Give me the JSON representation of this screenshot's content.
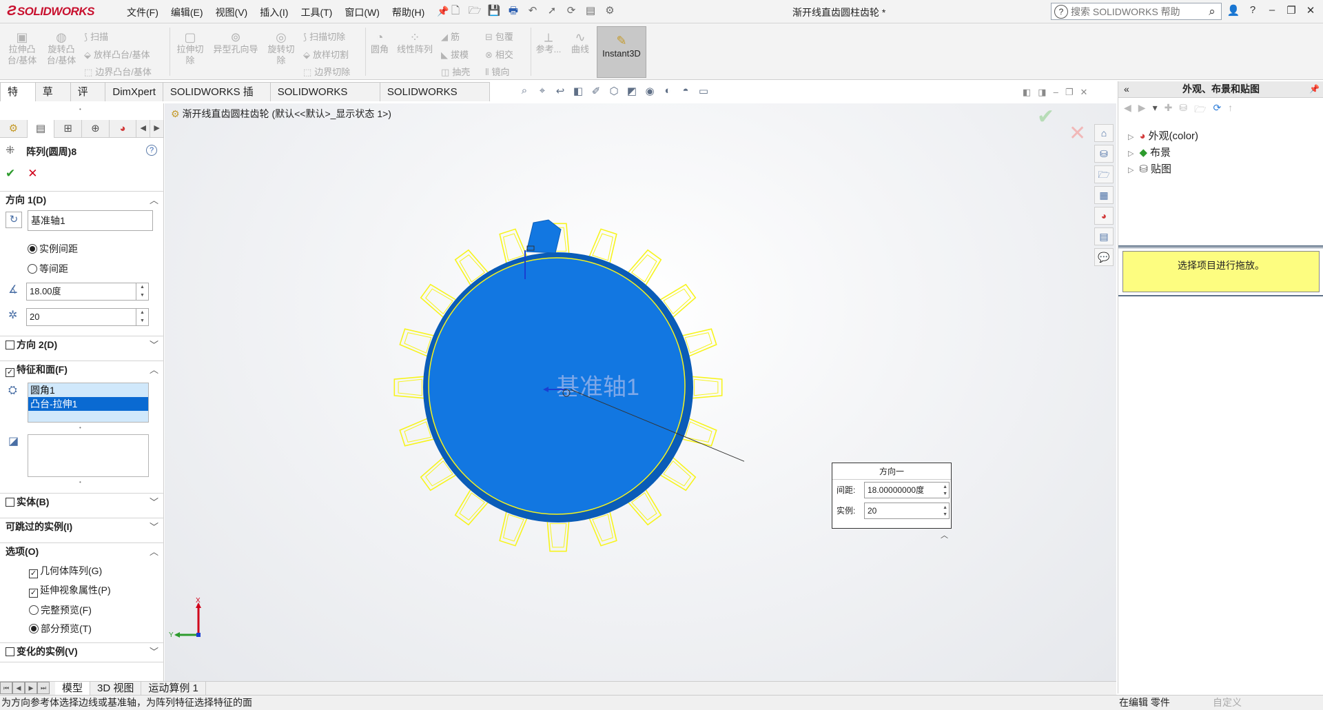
{
  "app": {
    "logo": "SOLIDWORKS",
    "document_title": "渐开线直齿圆柱齿轮 *",
    "menus": [
      "文件(F)",
      "编辑(E)",
      "视图(V)",
      "插入(I)",
      "工具(T)",
      "窗口(W)",
      "帮助(H)"
    ],
    "search_placeholder": "搜索 SOLIDWORKS 帮助"
  },
  "command_manager": {
    "extrude_boss": "拉伸凸\n台/基体",
    "revolve_boss": "旋转凸\n台/基体",
    "sweep": "扫描",
    "loft": "放样凸台/基体",
    "boundary": "边界凸台/基体",
    "extrude_cut": "拉伸切\n除",
    "hole_wizard": "异型孔向导",
    "revolve_cut": "旋转切\n除",
    "swept_cut": "扫描切除",
    "lofted_cut": "放样切割",
    "boundary_cut": "边界切除",
    "fillet": "圆角",
    "linear_pattern": "线性阵列",
    "rib": "筋",
    "draft": "拔模",
    "shell": "抽壳",
    "wrap": "包覆",
    "intersect": "相交",
    "mirror": "镜向",
    "reference": "参考...",
    "curves": "曲线",
    "instant3d": "Instant3D"
  },
  "tabs": [
    "特征",
    "草图",
    "评估",
    "DimXpert",
    "SOLIDWORKS 插件",
    "SOLIDWORKS MBD",
    "SOLIDWORKS CAM"
  ],
  "property_manager": {
    "title": "阵列(圆周)8",
    "direction1": {
      "header": "方向 1(D)",
      "axis": "基准轴1",
      "instance_spacing": "实例间距",
      "equal_spacing": "等间距",
      "angle": "18.00度",
      "count": "20"
    },
    "direction2": {
      "header": "方向 2(D)"
    },
    "features_faces": {
      "header": "特征和面(F)",
      "items": [
        "圆角1",
        "凸台-拉伸1"
      ]
    },
    "bodies": {
      "header": "实体(B)"
    },
    "skip_instances": {
      "header": "可跳过的实例(I)"
    },
    "options": {
      "header": "选项(O)",
      "geometry_pattern": "几何体阵列(G)",
      "propagate_visual": "延伸视象属性(P)",
      "full_preview": "完整预览(F)",
      "partial_preview": "部分预览(T)"
    },
    "vary_instances": {
      "header": "变化的实例(V)"
    }
  },
  "graphics": {
    "breadcrumb": "渐开线直齿圆柱齿轮  (默认<<默认>_显示状态 1>)",
    "axis_label": "基准轴1",
    "callout": {
      "title": "方向一",
      "spacing_label": "间距:",
      "spacing_value": "18.00000000度",
      "count_label": "实例:",
      "count_value": "20"
    },
    "triad_x": "X",
    "triad_y": "Y",
    "gear_teeth": 20
  },
  "bottom_tabs": [
    "模型",
    "3D 视图",
    "运动算例 1"
  ],
  "status": {
    "message": "为方向参考体选择边线或基准轴，为阵列特征选择特征的面",
    "mode": "在编辑 零件",
    "customize": "自定义"
  },
  "right_panel": {
    "title": "外观、布景和贴图",
    "tree": [
      "外观(color)",
      "布景",
      "贴图"
    ],
    "hint": "选择项目进行拖放。"
  },
  "colors": {
    "gear_fill": "#1277e1",
    "gear_dark": "#0a5cb8",
    "preview": "#f7f41c",
    "hint_bg": "#fdfd80"
  }
}
